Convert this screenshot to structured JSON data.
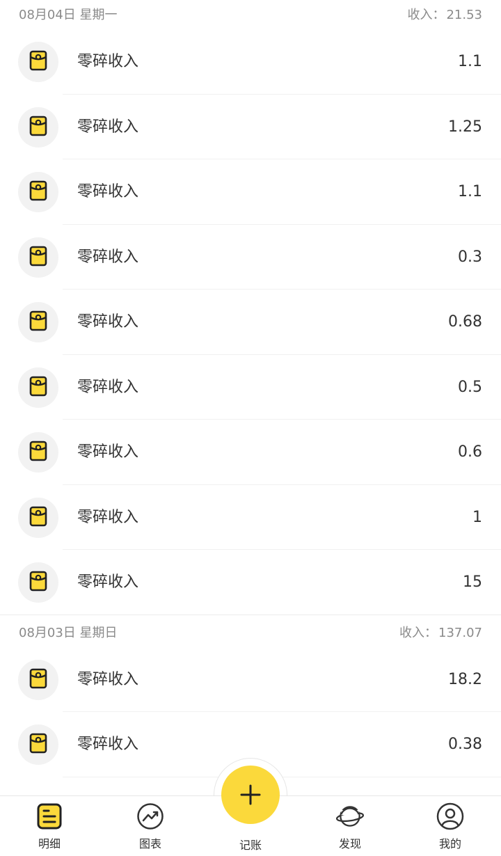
{
  "days": [
    {
      "date": "08月04日",
      "weekday": "星期一",
      "sum_label": "收入：",
      "sum_value": "21.53",
      "items": [
        {
          "label": "零碎收入",
          "amount": "1.1"
        },
        {
          "label": "零碎收入",
          "amount": "1.25"
        },
        {
          "label": "零碎收入",
          "amount": "1.1"
        },
        {
          "label": "零碎收入",
          "amount": "0.3"
        },
        {
          "label": "零碎收入",
          "amount": "0.68"
        },
        {
          "label": "零碎收入",
          "amount": "0.5"
        },
        {
          "label": "零碎收入",
          "amount": "0.6"
        },
        {
          "label": "零碎收入",
          "amount": "1"
        },
        {
          "label": "零碎收入",
          "amount": "15"
        }
      ]
    },
    {
      "date": "08月03日",
      "weekday": "星期日",
      "sum_label": "收入：",
      "sum_value": "137.07",
      "items": [
        {
          "label": "零碎收入",
          "amount": "18.2"
        },
        {
          "label": "零碎收入",
          "amount": "0.38"
        }
      ]
    }
  ],
  "item_icon": "red-envelope-icon",
  "colors": {
    "accent": "#fbd93b",
    "text": "#333333",
    "muted": "#8a8a8a"
  },
  "tabbar": {
    "tabs": [
      {
        "label": "明细",
        "icon": "list-icon"
      },
      {
        "label": "图表",
        "icon": "chart-icon"
      },
      {
        "label": "记账",
        "icon": "plus-icon"
      },
      {
        "label": "发现",
        "icon": "planet-icon"
      },
      {
        "label": "我的",
        "icon": "user-icon"
      }
    ]
  }
}
